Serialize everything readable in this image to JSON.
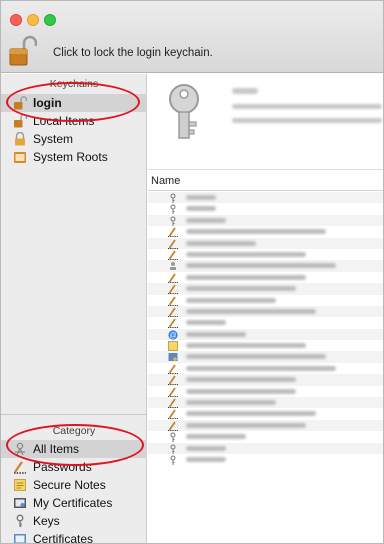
{
  "toolbar": {
    "lock_message": "Click to lock the login keychain."
  },
  "sidebar": {
    "keychains_header": "Keychains",
    "keychains": [
      {
        "label": "login",
        "icon": "lock-open-icon",
        "selected": true,
        "bold": true
      },
      {
        "label": "Local Items",
        "icon": "lock-open-icon",
        "selected": false,
        "bold": false
      },
      {
        "label": "System",
        "icon": "lock-icon",
        "selected": false,
        "bold": false
      },
      {
        "label": "System Roots",
        "icon": "certificate-folder-icon",
        "selected": false,
        "bold": false
      }
    ],
    "category_header": "Category",
    "categories": [
      {
        "label": "All Items",
        "icon": "all-items-icon",
        "selected": true
      },
      {
        "label": "Passwords",
        "icon": "pencil-icon",
        "selected": false
      },
      {
        "label": "Secure Notes",
        "icon": "note-icon",
        "selected": false
      },
      {
        "label": "My Certificates",
        "icon": "certificate-icon",
        "selected": false
      },
      {
        "label": "Keys",
        "icon": "key-icon",
        "selected": false
      },
      {
        "label": "Certificates",
        "icon": "certificate-icon",
        "selected": false
      }
    ]
  },
  "main": {
    "column_name": "Name",
    "row_icons": [
      "key",
      "key",
      "key",
      "pencil",
      "pencil",
      "pencil",
      "person",
      "pencil",
      "pencil",
      "pencil",
      "pencil",
      "pencil",
      "at",
      "note",
      "cert",
      "pencil",
      "pencil",
      "pencil",
      "pencil",
      "pencil",
      "pencil",
      "key",
      "key",
      "key"
    ]
  },
  "colors": {
    "annotation": "#e0141e",
    "selection": "#d3d3d3",
    "sidebar_bg": "#ececec"
  }
}
